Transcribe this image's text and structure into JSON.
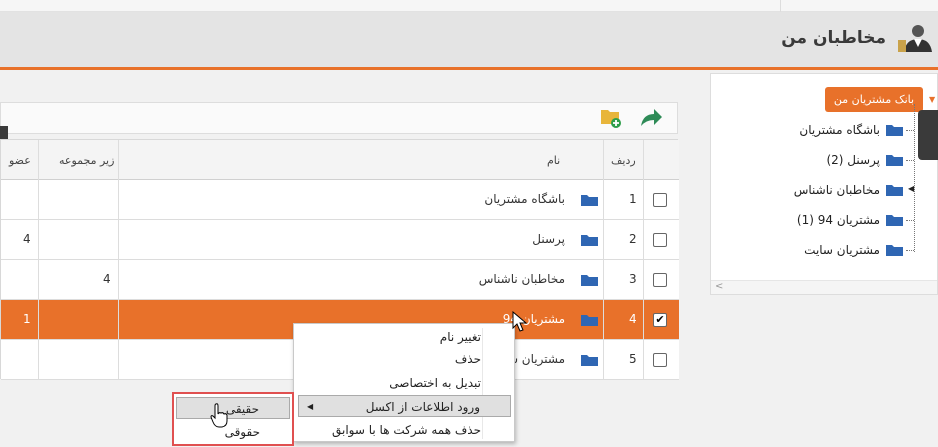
{
  "header": {
    "title": "مخاطبان من"
  },
  "tree": {
    "root_label": "بانک مشتریان من",
    "items": [
      {
        "label": "باشگاه مشتریان"
      },
      {
        "label": "پرسنل (2)"
      },
      {
        "label": "مخاطبان ناشناس"
      },
      {
        "label": "مشتریان 94 (1)"
      },
      {
        "label": "مشتریان سایت"
      }
    ]
  },
  "grid": {
    "columns": {
      "row": "ردیف",
      "name": "نام",
      "sub": "زیر مجموعه",
      "member": "عضو"
    },
    "rows": [
      {
        "num": "1",
        "name": "باشگاه مشتریان",
        "sub": "",
        "member": "",
        "checked": false
      },
      {
        "num": "2",
        "name": "پرسنل",
        "sub": "",
        "member": "4",
        "checked": false
      },
      {
        "num": "3",
        "name": "مخاطبان ناشناس",
        "sub": "4",
        "member": "",
        "checked": false
      },
      {
        "num": "4",
        "name": "مشتریان 94",
        "sub": "",
        "member": "1",
        "checked": true
      },
      {
        "num": "5",
        "name": "مشتریان سا",
        "sub": "",
        "member": "",
        "checked": false
      }
    ]
  },
  "context_menu": {
    "items": [
      {
        "label": "تغییر نام"
      },
      {
        "label": "حذف"
      },
      {
        "label": "تبدیل به اختصاصی"
      },
      {
        "label": "ورود اطلاعات از اکسل"
      },
      {
        "label": "حذف همه شرکت ها با سوابق"
      }
    ]
  },
  "submenu": {
    "items": [
      {
        "label": "حقیقی"
      },
      {
        "label": "حقوقی"
      }
    ]
  },
  "colors": {
    "accent": "#e8712a",
    "folder": "#2f66b3",
    "highlight_box": "#e05050"
  }
}
